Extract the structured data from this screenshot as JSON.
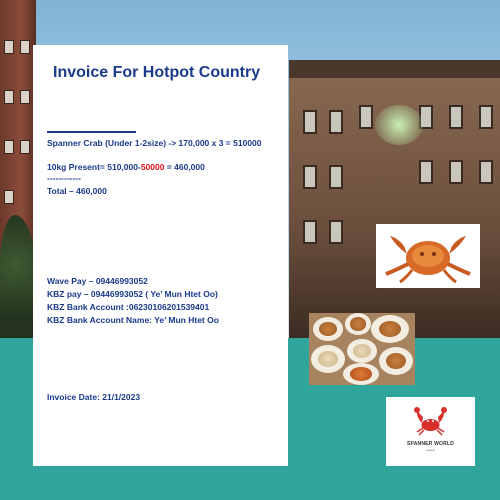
{
  "invoice": {
    "title": "Invoice For Hotpot Country",
    "line1": "Spanner Crab (Under 1-2size) -> 170,000 x 3 = 510000",
    "line2_prefix": "10kg Present= 510,000-",
    "line2_discount": "50000",
    "line2_suffix": " = 460,000",
    "separator": "------------",
    "total": "Total – 460,000",
    "payment": {
      "wave_pay": "Wave Pay – 09446993052",
      "kbz_pay": "KBZ pay – 09446993052 ( Ye’ Mun Htet Oo)",
      "kbz_account": "KBZ Bank Account :06230106201539401",
      "kbz_account_name": "KBZ Bank Account Name: Ye’ Mun Htet Oo"
    },
    "invoice_date": "Invoice Date: 21/1/2023"
  },
  "logo": {
    "name": "SPANNER WORLD",
    "sub": "seafood",
    "icon": "crab-icon"
  },
  "colors": {
    "title_blue": "#1a3a8c",
    "discount_red": "#e0141b",
    "teal_background": "#2fa59b",
    "logo_red": "#d9302b"
  }
}
